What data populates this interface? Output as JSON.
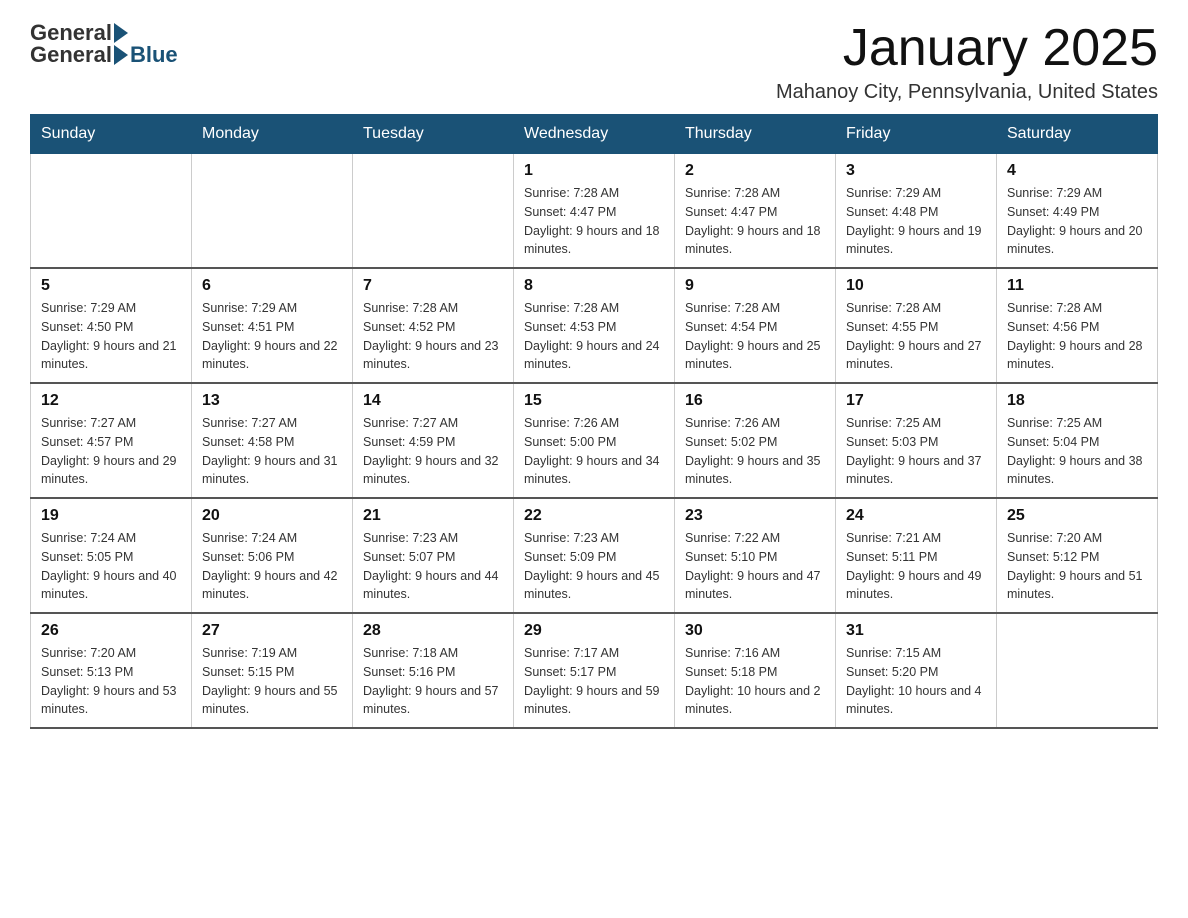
{
  "logo": {
    "general": "General",
    "blue": "Blue"
  },
  "title": "January 2025",
  "location": "Mahanoy City, Pennsylvania, United States",
  "days_of_week": [
    "Sunday",
    "Monday",
    "Tuesday",
    "Wednesday",
    "Thursday",
    "Friday",
    "Saturday"
  ],
  "weeks": [
    [
      {
        "day": "",
        "info": ""
      },
      {
        "day": "",
        "info": ""
      },
      {
        "day": "",
        "info": ""
      },
      {
        "day": "1",
        "info": "Sunrise: 7:28 AM\nSunset: 4:47 PM\nDaylight: 9 hours\nand 18 minutes."
      },
      {
        "day": "2",
        "info": "Sunrise: 7:28 AM\nSunset: 4:47 PM\nDaylight: 9 hours\nand 18 minutes."
      },
      {
        "day": "3",
        "info": "Sunrise: 7:29 AM\nSunset: 4:48 PM\nDaylight: 9 hours\nand 19 minutes."
      },
      {
        "day": "4",
        "info": "Sunrise: 7:29 AM\nSunset: 4:49 PM\nDaylight: 9 hours\nand 20 minutes."
      }
    ],
    [
      {
        "day": "5",
        "info": "Sunrise: 7:29 AM\nSunset: 4:50 PM\nDaylight: 9 hours\nand 21 minutes."
      },
      {
        "day": "6",
        "info": "Sunrise: 7:29 AM\nSunset: 4:51 PM\nDaylight: 9 hours\nand 22 minutes."
      },
      {
        "day": "7",
        "info": "Sunrise: 7:28 AM\nSunset: 4:52 PM\nDaylight: 9 hours\nand 23 minutes."
      },
      {
        "day": "8",
        "info": "Sunrise: 7:28 AM\nSunset: 4:53 PM\nDaylight: 9 hours\nand 24 minutes."
      },
      {
        "day": "9",
        "info": "Sunrise: 7:28 AM\nSunset: 4:54 PM\nDaylight: 9 hours\nand 25 minutes."
      },
      {
        "day": "10",
        "info": "Sunrise: 7:28 AM\nSunset: 4:55 PM\nDaylight: 9 hours\nand 27 minutes."
      },
      {
        "day": "11",
        "info": "Sunrise: 7:28 AM\nSunset: 4:56 PM\nDaylight: 9 hours\nand 28 minutes."
      }
    ],
    [
      {
        "day": "12",
        "info": "Sunrise: 7:27 AM\nSunset: 4:57 PM\nDaylight: 9 hours\nand 29 minutes."
      },
      {
        "day": "13",
        "info": "Sunrise: 7:27 AM\nSunset: 4:58 PM\nDaylight: 9 hours\nand 31 minutes."
      },
      {
        "day": "14",
        "info": "Sunrise: 7:27 AM\nSunset: 4:59 PM\nDaylight: 9 hours\nand 32 minutes."
      },
      {
        "day": "15",
        "info": "Sunrise: 7:26 AM\nSunset: 5:00 PM\nDaylight: 9 hours\nand 34 minutes."
      },
      {
        "day": "16",
        "info": "Sunrise: 7:26 AM\nSunset: 5:02 PM\nDaylight: 9 hours\nand 35 minutes."
      },
      {
        "day": "17",
        "info": "Sunrise: 7:25 AM\nSunset: 5:03 PM\nDaylight: 9 hours\nand 37 minutes."
      },
      {
        "day": "18",
        "info": "Sunrise: 7:25 AM\nSunset: 5:04 PM\nDaylight: 9 hours\nand 38 minutes."
      }
    ],
    [
      {
        "day": "19",
        "info": "Sunrise: 7:24 AM\nSunset: 5:05 PM\nDaylight: 9 hours\nand 40 minutes."
      },
      {
        "day": "20",
        "info": "Sunrise: 7:24 AM\nSunset: 5:06 PM\nDaylight: 9 hours\nand 42 minutes."
      },
      {
        "day": "21",
        "info": "Sunrise: 7:23 AM\nSunset: 5:07 PM\nDaylight: 9 hours\nand 44 minutes."
      },
      {
        "day": "22",
        "info": "Sunrise: 7:23 AM\nSunset: 5:09 PM\nDaylight: 9 hours\nand 45 minutes."
      },
      {
        "day": "23",
        "info": "Sunrise: 7:22 AM\nSunset: 5:10 PM\nDaylight: 9 hours\nand 47 minutes."
      },
      {
        "day": "24",
        "info": "Sunrise: 7:21 AM\nSunset: 5:11 PM\nDaylight: 9 hours\nand 49 minutes."
      },
      {
        "day": "25",
        "info": "Sunrise: 7:20 AM\nSunset: 5:12 PM\nDaylight: 9 hours\nand 51 minutes."
      }
    ],
    [
      {
        "day": "26",
        "info": "Sunrise: 7:20 AM\nSunset: 5:13 PM\nDaylight: 9 hours\nand 53 minutes."
      },
      {
        "day": "27",
        "info": "Sunrise: 7:19 AM\nSunset: 5:15 PM\nDaylight: 9 hours\nand 55 minutes."
      },
      {
        "day": "28",
        "info": "Sunrise: 7:18 AM\nSunset: 5:16 PM\nDaylight: 9 hours\nand 57 minutes."
      },
      {
        "day": "29",
        "info": "Sunrise: 7:17 AM\nSunset: 5:17 PM\nDaylight: 9 hours\nand 59 minutes."
      },
      {
        "day": "30",
        "info": "Sunrise: 7:16 AM\nSunset: 5:18 PM\nDaylight: 10 hours\nand 2 minutes."
      },
      {
        "day": "31",
        "info": "Sunrise: 7:15 AM\nSunset: 5:20 PM\nDaylight: 10 hours\nand 4 minutes."
      },
      {
        "day": "",
        "info": ""
      }
    ]
  ]
}
